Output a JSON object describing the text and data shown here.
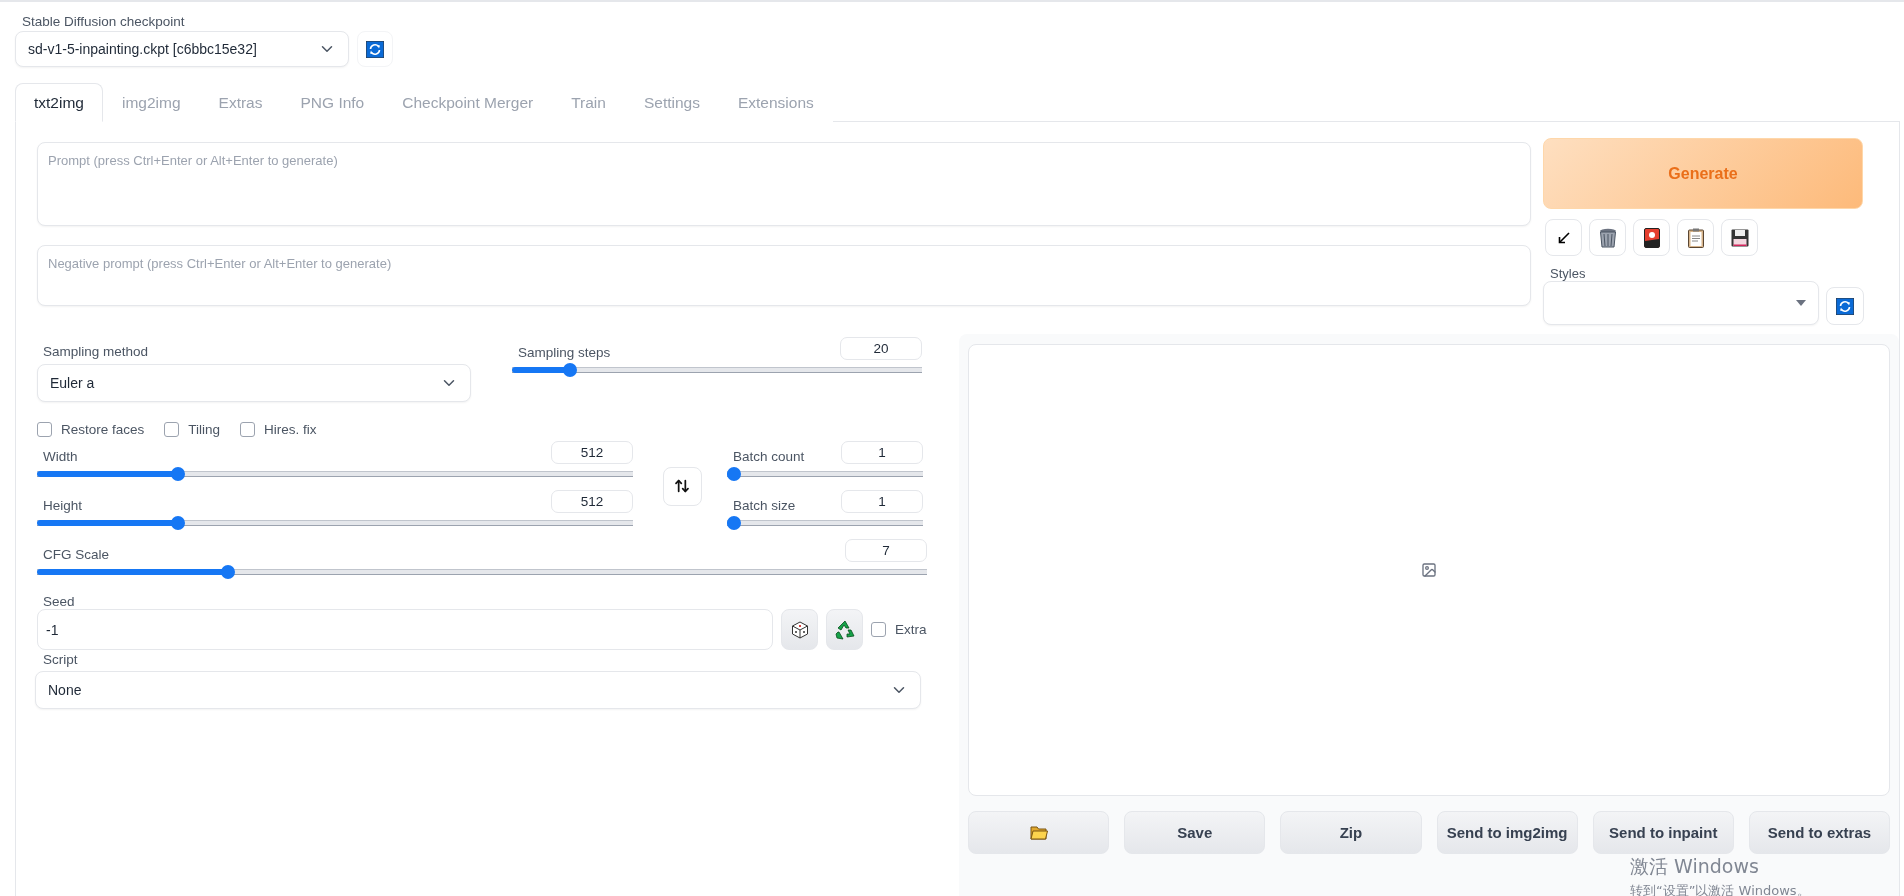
{
  "checkpoint": {
    "label": "Stable Diffusion checkpoint",
    "value": "sd-v1-5-inpainting.ckpt [c6bbc15e32]"
  },
  "tabs": [
    {
      "label": "txt2img",
      "selected": true
    },
    {
      "label": "img2img",
      "selected": false
    },
    {
      "label": "Extras",
      "selected": false
    },
    {
      "label": "PNG Info",
      "selected": false
    },
    {
      "label": "Checkpoint Merger",
      "selected": false
    },
    {
      "label": "Train",
      "selected": false
    },
    {
      "label": "Settings",
      "selected": false
    },
    {
      "label": "Extensions",
      "selected": false
    }
  ],
  "prompt": {
    "placeholder": "Prompt (press Ctrl+Enter or Alt+Enter to generate)"
  },
  "negative_prompt": {
    "placeholder": "Negative prompt (press Ctrl+Enter or Alt+Enter to generate)"
  },
  "generate": "Generate",
  "styles": {
    "label": "Styles"
  },
  "sampling_method": {
    "label": "Sampling method",
    "value": "Euler a"
  },
  "sampling_steps": {
    "label": "Sampling steps",
    "value": "20",
    "level": 0.13
  },
  "checkboxes": [
    {
      "label": "Restore faces",
      "checked": false
    },
    {
      "label": "Tiling",
      "checked": false
    },
    {
      "label": "Hires. fix",
      "checked": false
    }
  ],
  "width": {
    "label": "Width",
    "value": "512",
    "level": 0.23
  },
  "height": {
    "label": "Height",
    "value": "512",
    "level": 0.23
  },
  "batch_count": {
    "label": "Batch count",
    "value": "1",
    "level": 0
  },
  "batch_size": {
    "label": "Batch size",
    "value": "1",
    "level": 0
  },
  "cfg_scale": {
    "label": "CFG Scale",
    "value": "7",
    "level": 0.21
  },
  "seed": {
    "label": "Seed",
    "value": "-1"
  },
  "extra": {
    "label": "Extra",
    "checked": false
  },
  "script": {
    "label": "Script",
    "value": "None"
  },
  "gallery_buttons": [
    "Save",
    "Zip",
    "Send to img2img",
    "Send to inpaint",
    "Send to extras"
  ],
  "activation_notice": {
    "title": "激活 Windows",
    "text": "转到“设置”以激活 Windows。"
  }
}
